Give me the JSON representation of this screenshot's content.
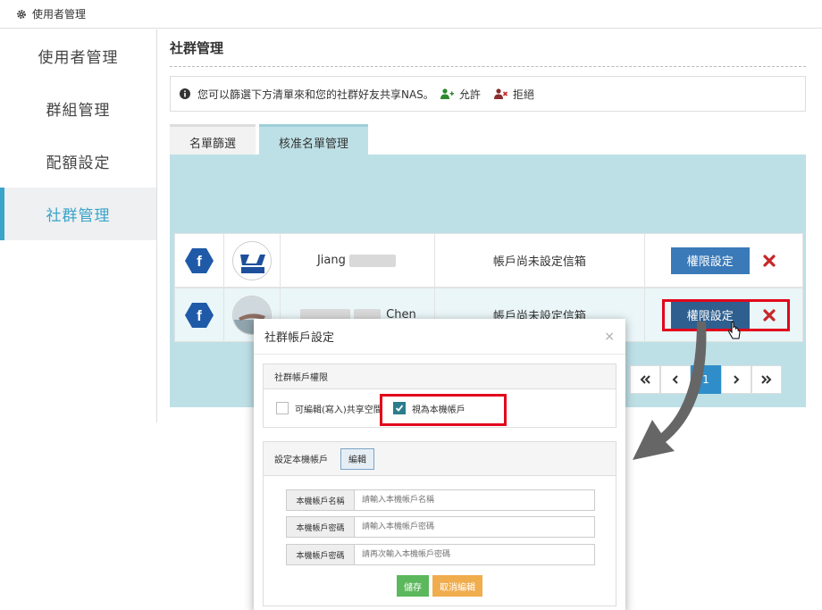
{
  "topbar": {
    "title": "使用者管理"
  },
  "sidebar": {
    "items": [
      {
        "label": "使用者管理"
      },
      {
        "label": "群組管理"
      },
      {
        "label": "配額設定"
      },
      {
        "label": "社群管理"
      }
    ],
    "active_index": 3
  },
  "main": {
    "title": "社群管理",
    "info": {
      "text": "您可以篩選下方清單來和您的社群好友共享NAS。",
      "allow": "允許",
      "deny": "拒絕"
    },
    "tabs": [
      {
        "label": "名單篩選"
      },
      {
        "label": "核准名單管理"
      }
    ],
    "rows": [
      {
        "name_visible": "Jiang",
        "email": "帳戶尚未設定信箱",
        "action": "權限設定"
      },
      {
        "name_visible": "Chen",
        "email": "帳戶尚未設定信箱",
        "action": "權限設定"
      }
    ],
    "pager": {
      "current": "1"
    }
  },
  "dialog": {
    "title": "社群帳戶設定",
    "close": "×",
    "perm_header": "社群帳戶權限",
    "opt_edit": "可編輯(寫入)共享空間",
    "opt_local": "視為本機帳戶",
    "local_header": "設定本機帳戶",
    "edit_btn": "編輯",
    "fields": [
      {
        "label": "本機帳戶名稱",
        "placeholder": "請輸入本機帳戶名稱"
      },
      {
        "label": "本機帳戶密碼",
        "placeholder": "請輸入本機帳戶密碼"
      },
      {
        "label": "本機帳戶密碼",
        "placeholder": "請再次輸入本機帳戶密碼"
      }
    ],
    "save": "儲存",
    "cancel": "取消編輯"
  },
  "colors": {
    "accent": "#3aa4c9",
    "panel": "#bde0e6",
    "button": "#3b7ab8",
    "highlight": "#e2061b",
    "fb": "#1f5aa8"
  },
  "icons": [
    "gear-icon",
    "info-icon",
    "user-plus-icon",
    "user-x-icon",
    "facebook-icon",
    "remove-icon",
    "first-page-icon",
    "prev-page-icon",
    "next-page-icon",
    "last-page-icon",
    "check-icon",
    "pointer-cursor-icon",
    "curved-arrow-icon"
  ]
}
